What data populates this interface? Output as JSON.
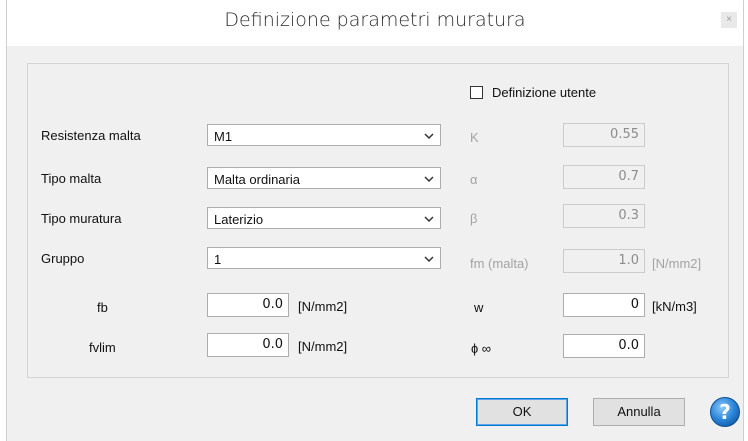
{
  "window": {
    "title": "Definizione parametri muratura",
    "close_glyph": "×"
  },
  "checkbox_user": {
    "label": "Definizione utente",
    "checked": false
  },
  "left_fields": [
    {
      "label": "Resistenza malta",
      "value": "M1"
    },
    {
      "label": "Tipo malta",
      "value": "Malta ordinaria"
    },
    {
      "label": "Tipo muratura",
      "value": "Laterizio"
    },
    {
      "label": "Gruppo",
      "value": "1"
    }
  ],
  "inputs": {
    "fb": {
      "label": "fb",
      "value": "0.0",
      "unit": "[N/mm2]"
    },
    "fvlim": {
      "label": "fvlim",
      "value": "0.0",
      "unit": "[N/mm2]"
    }
  },
  "right_params": {
    "K": {
      "label": "K",
      "value": "0.55"
    },
    "alpha": {
      "label": "α",
      "value": "0.7"
    },
    "beta": {
      "label": "β",
      "value": "0.3"
    },
    "fm": {
      "label": "fm (malta)",
      "value": "1.0",
      "unit": "[N/mm2]"
    },
    "w": {
      "label": "w",
      "value": "0",
      "unit": "[kN/m3]"
    },
    "phi": {
      "label": "ɸ ∞",
      "value": "0.0"
    }
  },
  "buttons": {
    "ok": "OK",
    "cancel": "Annulla",
    "help_glyph": "?"
  },
  "colors": {
    "accent": "#0078d7",
    "help_blue": "#1f7fd6"
  }
}
